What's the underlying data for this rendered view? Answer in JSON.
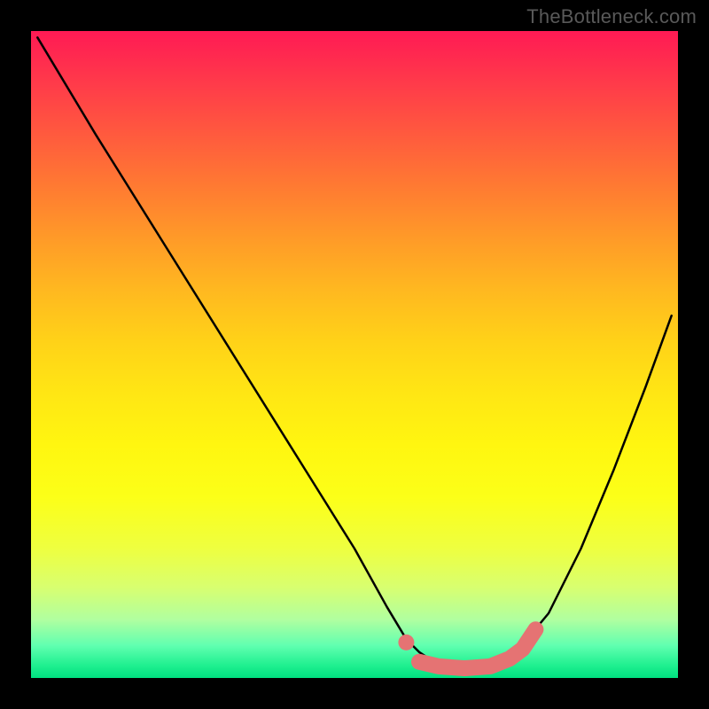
{
  "watermark": "TheBottleneck.com",
  "chart_data": {
    "type": "line",
    "title": "",
    "xlabel": "",
    "ylabel": "",
    "xlim": [
      0,
      100
    ],
    "ylim": [
      0,
      100
    ],
    "series": [
      {
        "name": "black-curve",
        "color": "#000000",
        "x": [
          1,
          10,
          20,
          30,
          40,
          50,
          55,
          58,
          60,
          63,
          67,
          71,
          75,
          80,
          85,
          90,
          95,
          99
        ],
        "y": [
          99,
          84,
          68,
          52,
          36,
          20,
          11,
          6,
          4,
          2,
          1.5,
          2,
          4,
          10,
          20,
          32,
          45,
          56
        ]
      },
      {
        "name": "salmon-marker-left",
        "type": "scatter",
        "color": "#e57373",
        "x": [
          58
        ],
        "y": [
          5.5
        ]
      },
      {
        "name": "salmon-band",
        "type": "line",
        "color": "#e57373",
        "thick": true,
        "x": [
          60,
          63,
          67,
          71,
          74,
          76,
          77,
          78
        ],
        "y": [
          2.5,
          1.8,
          1.5,
          1.8,
          3,
          4.5,
          6,
          7.5
        ]
      }
    ],
    "background_gradient": {
      "top_color": "#ff1a54",
      "bottom_color": "#00e080"
    }
  }
}
